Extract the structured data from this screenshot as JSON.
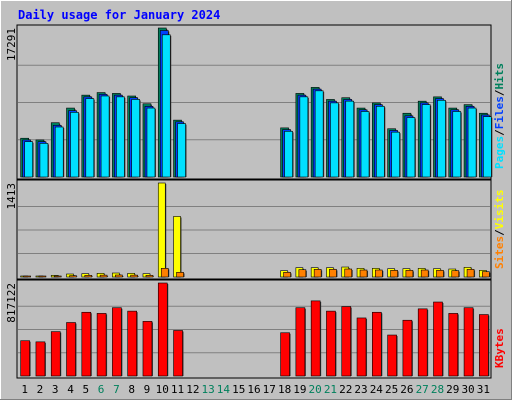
{
  "chart_data": {
    "type": "bar",
    "title": "Daily usage for January 2024",
    "days": [
      "1",
      "2",
      "3",
      "4",
      "5",
      "6",
      "7",
      "8",
      "9",
      "10",
      "11",
      "12",
      "13",
      "14",
      "15",
      "16",
      "17",
      "18",
      "19",
      "20",
      "21",
      "22",
      "23",
      "24",
      "25",
      "26",
      "27",
      "28",
      "29",
      "30",
      "31"
    ],
    "weekend_days": [
      "6",
      "7",
      "13",
      "14",
      "20",
      "21",
      "27",
      "28"
    ],
    "panels": [
      {
        "id": "hits",
        "ymax": 17291,
        "max_label": "17291",
        "legend": [
          "Pages",
          "/",
          "Files",
          "/",
          "Hits"
        ],
        "series": [
          {
            "name": "Hits",
            "color": "#00805c",
            "values": [
              4500,
              4300,
              6300,
              8000,
              9500,
              9800,
              9700,
              9400,
              8500,
              17291,
              6600,
              0,
              0,
              0,
              0,
              0,
              0,
              5700,
              9700,
              10400,
              9000,
              9200,
              8000,
              8600,
              5600,
              7400,
              8800,
              9300,
              8000,
              8400,
              7400
            ]
          },
          {
            "name": "Files",
            "color": "#0040ff",
            "values": [
              4300,
              4100,
              6000,
              7700,
              9300,
              9600,
              9500,
              9200,
              8200,
              17000,
              6400,
              0,
              0,
              0,
              0,
              0,
              0,
              5500,
              9500,
              10200,
              8800,
              9000,
              7800,
              8400,
              5400,
              7100,
              8600,
              9100,
              7800,
              8200,
              7200
            ]
          },
          {
            "name": "Pages",
            "color": "#00e0ff",
            "values": [
              4100,
              3900,
              5800,
              7500,
              9100,
              9400,
              9300,
              9000,
              8000,
              16500,
              6200,
              0,
              0,
              0,
              0,
              0,
              0,
              5300,
              9300,
              10000,
              8600,
              8800,
              7600,
              8200,
              5200,
              6900,
              8400,
              8900,
              7600,
              8000,
              7000
            ]
          }
        ]
      },
      {
        "id": "visits",
        "ymax": 1413,
        "max_label": "1413",
        "legend": [
          "Sites",
          "/",
          "Visits"
        ],
        "series": [
          {
            "name": "Visits",
            "color": "#ffff00",
            "values": [
              15,
              15,
              25,
              45,
              50,
              55,
              60,
              55,
              50,
              1413,
              910,
              0,
              0,
              0,
              0,
              0,
              0,
              95,
              140,
              140,
              140,
              150,
              130,
              130,
              125,
              125,
              130,
              125,
              120,
              145,
              100
            ]
          },
          {
            "name": "Sites",
            "color": "#ff8000",
            "values": [
              8,
              8,
              12,
              20,
              25,
              28,
              30,
              28,
              25,
              130,
              70,
              0,
              0,
              0,
              0,
              0,
              0,
              70,
              110,
              115,
              115,
              120,
              105,
              105,
              100,
              100,
              105,
              100,
              95,
              115,
              80
            ]
          }
        ]
      },
      {
        "id": "kbytes",
        "ymax": 817122,
        "max_label": "817122",
        "legend": [
          "KBytes"
        ],
        "series": [
          {
            "name": "KBytes",
            "color": "#ff0000",
            "values": [
              310000,
              300000,
              390000,
              470000,
              560000,
              550000,
              600000,
              570000,
              480000,
              817122,
              400000,
              0,
              0,
              0,
              0,
              0,
              0,
              380000,
              600000,
              660000,
              570000,
              610000,
              510000,
              560000,
              360000,
              490000,
              590000,
              650000,
              550000,
              600000,
              540000
            ]
          }
        ]
      }
    ]
  },
  "colors": {
    "background": "#c0c0c0",
    "plot": "#c0c0c0",
    "grid": "#808080",
    "title": "#0000ff",
    "weekday_label": "#000000",
    "weekend_label": "#00805c",
    "shadow": "#404040"
  }
}
